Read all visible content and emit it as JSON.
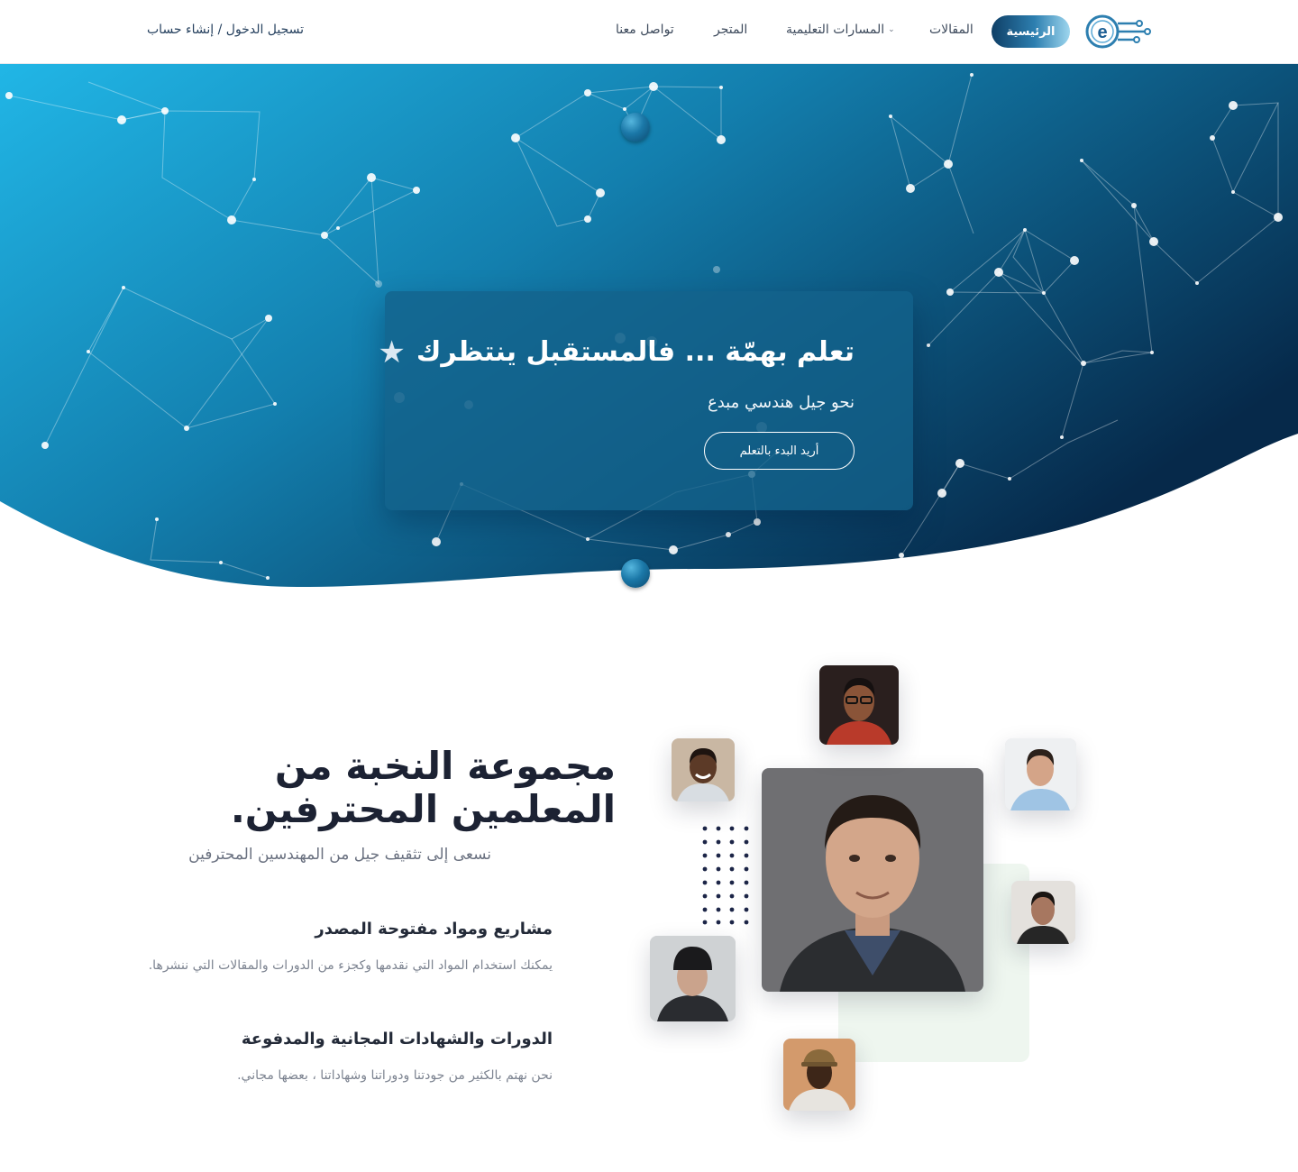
{
  "nav": {
    "logo_letter": "e",
    "home": "الرئيسية",
    "articles": "المقالات",
    "learning_paths": "المسارات التعليمية",
    "store": "المتجر",
    "contact": "تواصل معنا",
    "login": "تسجيل الدخول / إنشاء حساب"
  },
  "hero": {
    "title": "تعلم بهمّة ... فالمستقبل ينتظرك",
    "subtitle": "نحو جيل هندسي مبدع",
    "cta": "أريد البدء بالتعلم",
    "title_icon": "star-icon"
  },
  "section": {
    "title_line1": "مجموعة النخبة من",
    "title_line2": "المعلمين المحترفين.",
    "subtitle": "نسعى إلى تثقيف جيل من المهندسين المحترفين"
  },
  "features": [
    {
      "title": "مشاريع ومواد مفتوحة المصدر",
      "desc": "يمكنك استخدام المواد التي نقدمها وكجزء من الدورات والمقالات التي ننشرها."
    },
    {
      "title": "الدورات والشهادات المجانية والمدفوعة",
      "desc": "نحن نهتم بالكثير من جودتنا ودوراتنا وشهاداتنا ، بعضها مجاني."
    }
  ],
  "colors": {
    "hero_dark": "#083a5e",
    "hero_light": "#1fb7e6",
    "accent": "#1b78a8",
    "text_dark": "#1c2233"
  }
}
